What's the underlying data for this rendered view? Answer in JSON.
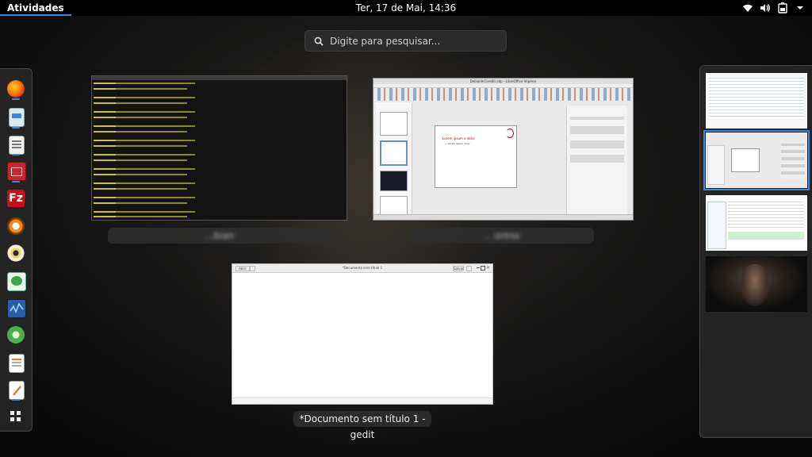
{
  "topbar": {
    "activities_label": "Atividades",
    "clock": "Ter, 17 de Mai, 14:36",
    "tray_icons": [
      "wifi-icon",
      "volume-icon",
      "battery-icon",
      "system-menu-arrow-icon"
    ]
  },
  "search": {
    "placeholder": "Digite para pesquisar..."
  },
  "dash": {
    "apps": [
      "firefox",
      "files",
      "document-viewer",
      "videos",
      "filezilla",
      "help",
      "cheese",
      "image-viewer",
      "system-monitor",
      "software",
      "text-document",
      "text-editor"
    ],
    "show_apps_icon": "grid-icon"
  },
  "windows": {
    "terminal_caption": "…bian",
    "impress_caption": "…oress",
    "impress_title": "DebianInCorkKit.odp - LibreOffice Impress",
    "impress_slide_title": "Lorem ipsum e dolor",
    "impress_slide_bullet": "• Lorem ipsum dolor",
    "gedit_title": "*Documento sem título 1",
    "gedit_caption": "*Documento sem título 1 - gedit",
    "gedit_open": "Abrir",
    "gedit_save": "Salvar"
  },
  "workspaces": {
    "count": 4,
    "active_index": 1
  },
  "colors": {
    "accent": "#3d86d8",
    "panel": "#262626"
  }
}
